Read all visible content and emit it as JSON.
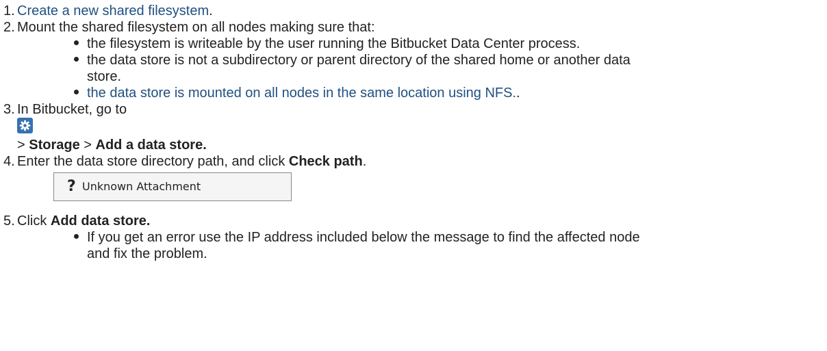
{
  "steps": [
    {
      "num": "1.",
      "link": "Create a new shared filesystem",
      "after": "."
    },
    {
      "num": "2.",
      "text": "Mount the shared filesystem on all nodes making sure that:",
      "bullets": [
        "the filesystem is writeable by the user running the Bitbucket Data Center process.",
        "the data store is not a subdirectory or parent directory of the shared home or another data",
        "store.",
        "the data store is mounted on all nodes in the same location using NFS."
      ],
      "bullet_link_after": "."
    },
    {
      "num": "3.",
      "text": "In Bitbucket, go to",
      "sep1": "> ",
      "b1": "Storage",
      "sep2": " > ",
      "b2": "Add a data store."
    },
    {
      "num": "4.",
      "text": "Enter the data store directory path, and click ",
      "bold": "Check path",
      "after": "."
    },
    {
      "num": "5.",
      "text": "Click ",
      "bold": "Add data store.",
      "bullets": [
        "If you get an error use the IP address included below the message to find the affected node",
        "and fix the problem."
      ]
    }
  ],
  "attachment": {
    "icon": "question-icon",
    "label": "Unknown Attachment"
  },
  "icons": {
    "settings": "gear-icon"
  },
  "colors": {
    "link": "#205081",
    "gear_bg": "#3572b0",
    "text": "#222222"
  }
}
